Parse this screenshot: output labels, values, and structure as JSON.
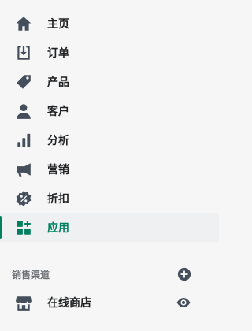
{
  "nav": {
    "items": [
      {
        "label": "主页",
        "icon": "home-icon"
      },
      {
        "label": "订单",
        "icon": "orders-icon"
      },
      {
        "label": "产品",
        "icon": "tag-icon"
      },
      {
        "label": "客户",
        "icon": "person-icon"
      },
      {
        "label": "分析",
        "icon": "bar-chart-icon"
      },
      {
        "label": "营销",
        "icon": "megaphone-icon"
      },
      {
        "label": "折扣",
        "icon": "discount-icon"
      },
      {
        "label": "应用",
        "icon": "apps-icon",
        "active": true
      }
    ]
  },
  "sales_channels": {
    "title": "销售渠道",
    "add_icon": "plus-circle-icon",
    "items": [
      {
        "label": "在线商店",
        "icon": "store-icon",
        "action_icon": "eye-icon"
      }
    ]
  },
  "colors": {
    "background": "#f6f6f7",
    "text": "#202223",
    "icon": "#454f5b",
    "active_text": "#007f5f",
    "active_bar": "#008060",
    "section_title": "#6d7175"
  }
}
